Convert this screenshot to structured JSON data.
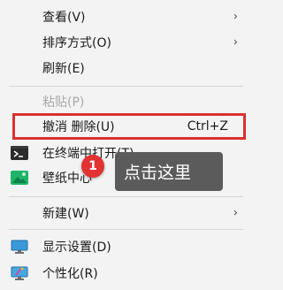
{
  "menu": {
    "items": [
      {
        "label": "查看(V)",
        "chevron": "›"
      },
      {
        "label": "排序方式(O)",
        "chevron": "›"
      },
      {
        "label": "刷新(E)"
      },
      {
        "label": "粘贴(P)"
      },
      {
        "label": "撤消 删除(U)",
        "shortcut": "Ctrl+Z"
      },
      {
        "label": "在终端中打开(T)",
        "icon": "terminal-icon"
      },
      {
        "label": "壁纸中心",
        "icon": "wallpaper-icon"
      },
      {
        "label": "新建(W)",
        "chevron": "›"
      },
      {
        "label": "显示设置(D)",
        "icon": "display-settings-icon"
      },
      {
        "label": "个性化(R)",
        "icon": "personalize-icon"
      }
    ]
  },
  "annotation": {
    "badge_number": "1",
    "tooltip_text": "点击这里",
    "highlight_color": "#d9312e",
    "badge_color": "#e23232",
    "tooltip_color": "#5b5b5b"
  }
}
